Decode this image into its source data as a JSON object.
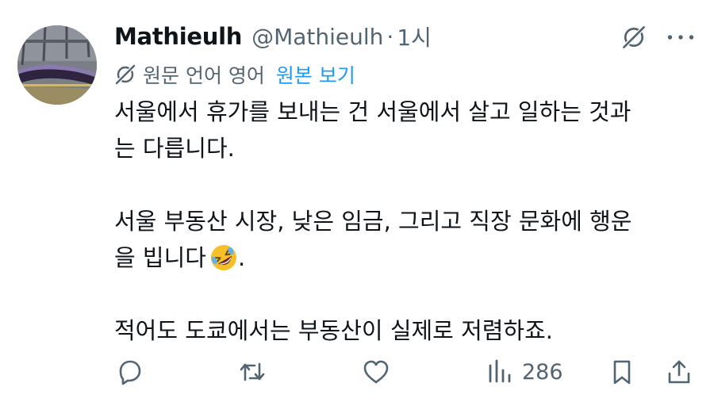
{
  "author": {
    "display_name": "Mathieulh",
    "handle": "@Mathieulh",
    "separator": "·",
    "time": "1시",
    "avatar_icon": "avatar-train-photo"
  },
  "translation": {
    "notice": "원문 언어 영어",
    "show_original": "원본 보기",
    "icon": "grok-icon"
  },
  "tweet": {
    "line1": "서울에서 휴가를 보내는 건 서울에서 살고 일하는 것과",
    "line2": "는 다릅니다.",
    "line3": "서울 부동산 시장, 낮은 임금, 그리고 직장 문화에 행운",
    "line4": "을 빕니다",
    "line4_suffix": ".",
    "emoji": "rolling-on-floor-laughing-emoji",
    "line5": "적어도 도쿄에서는 부동산이 실제로 저렴하죠."
  },
  "actions": {
    "reply_icon": "reply-icon",
    "retweet_icon": "retweet-icon",
    "like_icon": "heart-icon",
    "views_icon": "views-icon",
    "views_count": "286",
    "bookmark_icon": "bookmark-icon",
    "share_icon": "share-icon"
  },
  "colors": {
    "text": "#0f1419",
    "secondary": "#536471",
    "link": "#1d9bf0",
    "emoji_yellow": "#f7c02a"
  }
}
